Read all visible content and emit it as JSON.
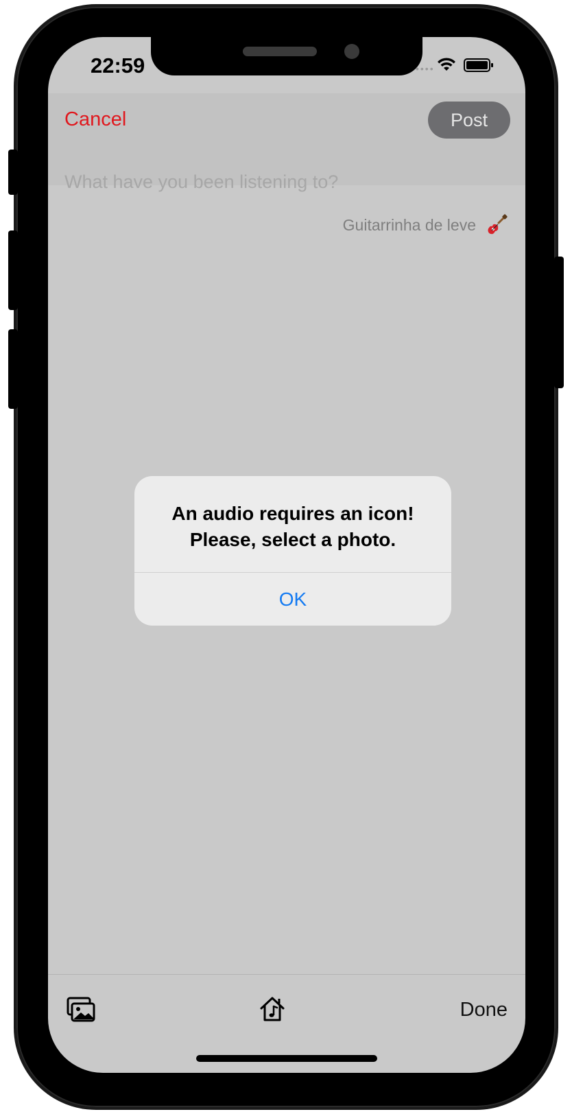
{
  "status_bar": {
    "time": "22:59",
    "signal_dots": "••••"
  },
  "header": {
    "cancel_label": "Cancel",
    "post_label": "Post"
  },
  "composer": {
    "placeholder": "What have you been listening to?",
    "song_label": "Guitarrinha de leve",
    "song_icon": "guitar-icon"
  },
  "alert": {
    "title_line1": "An audio requires an icon!",
    "title_line2": "Please, select a photo.",
    "ok_label": "OK"
  },
  "toolbar": {
    "photos_icon": "photos-icon",
    "home_music_icon": "home-music-icon",
    "done_label": "Done"
  },
  "colors": {
    "cancel": "#e0181e",
    "alert_button": "#137af2",
    "post_button_bg": "#6d6d70",
    "screen_bg": "#c9c9c9"
  }
}
